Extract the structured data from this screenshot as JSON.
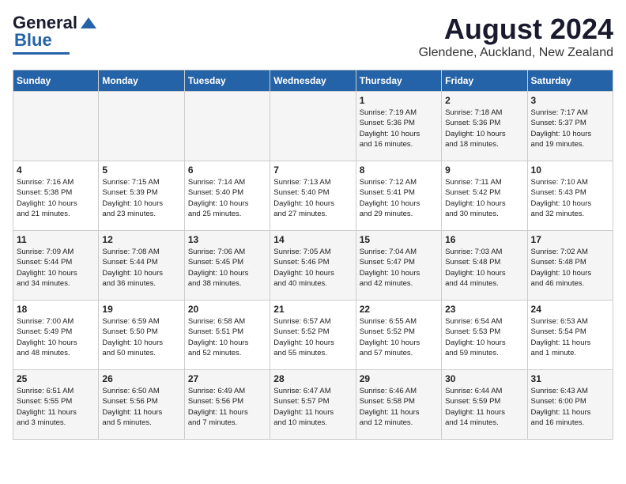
{
  "logo": {
    "line1": "General",
    "line2": "Blue"
  },
  "title": "August 2024",
  "subtitle": "Glendene, Auckland, New Zealand",
  "headers": [
    "Sunday",
    "Monday",
    "Tuesday",
    "Wednesday",
    "Thursday",
    "Friday",
    "Saturday"
  ],
  "weeks": [
    [
      {
        "day": "",
        "content": ""
      },
      {
        "day": "",
        "content": ""
      },
      {
        "day": "",
        "content": ""
      },
      {
        "day": "",
        "content": ""
      },
      {
        "day": "1",
        "content": "Sunrise: 7:19 AM\nSunset: 5:36 PM\nDaylight: 10 hours\nand 16 minutes."
      },
      {
        "day": "2",
        "content": "Sunrise: 7:18 AM\nSunset: 5:36 PM\nDaylight: 10 hours\nand 18 minutes."
      },
      {
        "day": "3",
        "content": "Sunrise: 7:17 AM\nSunset: 5:37 PM\nDaylight: 10 hours\nand 19 minutes."
      }
    ],
    [
      {
        "day": "4",
        "content": "Sunrise: 7:16 AM\nSunset: 5:38 PM\nDaylight: 10 hours\nand 21 minutes."
      },
      {
        "day": "5",
        "content": "Sunrise: 7:15 AM\nSunset: 5:39 PM\nDaylight: 10 hours\nand 23 minutes."
      },
      {
        "day": "6",
        "content": "Sunrise: 7:14 AM\nSunset: 5:40 PM\nDaylight: 10 hours\nand 25 minutes."
      },
      {
        "day": "7",
        "content": "Sunrise: 7:13 AM\nSunset: 5:40 PM\nDaylight: 10 hours\nand 27 minutes."
      },
      {
        "day": "8",
        "content": "Sunrise: 7:12 AM\nSunset: 5:41 PM\nDaylight: 10 hours\nand 29 minutes."
      },
      {
        "day": "9",
        "content": "Sunrise: 7:11 AM\nSunset: 5:42 PM\nDaylight: 10 hours\nand 30 minutes."
      },
      {
        "day": "10",
        "content": "Sunrise: 7:10 AM\nSunset: 5:43 PM\nDaylight: 10 hours\nand 32 minutes."
      }
    ],
    [
      {
        "day": "11",
        "content": "Sunrise: 7:09 AM\nSunset: 5:44 PM\nDaylight: 10 hours\nand 34 minutes."
      },
      {
        "day": "12",
        "content": "Sunrise: 7:08 AM\nSunset: 5:44 PM\nDaylight: 10 hours\nand 36 minutes."
      },
      {
        "day": "13",
        "content": "Sunrise: 7:06 AM\nSunset: 5:45 PM\nDaylight: 10 hours\nand 38 minutes."
      },
      {
        "day": "14",
        "content": "Sunrise: 7:05 AM\nSunset: 5:46 PM\nDaylight: 10 hours\nand 40 minutes."
      },
      {
        "day": "15",
        "content": "Sunrise: 7:04 AM\nSunset: 5:47 PM\nDaylight: 10 hours\nand 42 minutes."
      },
      {
        "day": "16",
        "content": "Sunrise: 7:03 AM\nSunset: 5:48 PM\nDaylight: 10 hours\nand 44 minutes."
      },
      {
        "day": "17",
        "content": "Sunrise: 7:02 AM\nSunset: 5:48 PM\nDaylight: 10 hours\nand 46 minutes."
      }
    ],
    [
      {
        "day": "18",
        "content": "Sunrise: 7:00 AM\nSunset: 5:49 PM\nDaylight: 10 hours\nand 48 minutes."
      },
      {
        "day": "19",
        "content": "Sunrise: 6:59 AM\nSunset: 5:50 PM\nDaylight: 10 hours\nand 50 minutes."
      },
      {
        "day": "20",
        "content": "Sunrise: 6:58 AM\nSunset: 5:51 PM\nDaylight: 10 hours\nand 52 minutes."
      },
      {
        "day": "21",
        "content": "Sunrise: 6:57 AM\nSunset: 5:52 PM\nDaylight: 10 hours\nand 55 minutes."
      },
      {
        "day": "22",
        "content": "Sunrise: 6:55 AM\nSunset: 5:52 PM\nDaylight: 10 hours\nand 57 minutes."
      },
      {
        "day": "23",
        "content": "Sunrise: 6:54 AM\nSunset: 5:53 PM\nDaylight: 10 hours\nand 59 minutes."
      },
      {
        "day": "24",
        "content": "Sunrise: 6:53 AM\nSunset: 5:54 PM\nDaylight: 11 hours\nand 1 minute."
      }
    ],
    [
      {
        "day": "25",
        "content": "Sunrise: 6:51 AM\nSunset: 5:55 PM\nDaylight: 11 hours\nand 3 minutes."
      },
      {
        "day": "26",
        "content": "Sunrise: 6:50 AM\nSunset: 5:56 PM\nDaylight: 11 hours\nand 5 minutes."
      },
      {
        "day": "27",
        "content": "Sunrise: 6:49 AM\nSunset: 5:56 PM\nDaylight: 11 hours\nand 7 minutes."
      },
      {
        "day": "28",
        "content": "Sunrise: 6:47 AM\nSunset: 5:57 PM\nDaylight: 11 hours\nand 10 minutes."
      },
      {
        "day": "29",
        "content": "Sunrise: 6:46 AM\nSunset: 5:58 PM\nDaylight: 11 hours\nand 12 minutes."
      },
      {
        "day": "30",
        "content": "Sunrise: 6:44 AM\nSunset: 5:59 PM\nDaylight: 11 hours\nand 14 minutes."
      },
      {
        "day": "31",
        "content": "Sunrise: 6:43 AM\nSunset: 6:00 PM\nDaylight: 11 hours\nand 16 minutes."
      }
    ]
  ]
}
